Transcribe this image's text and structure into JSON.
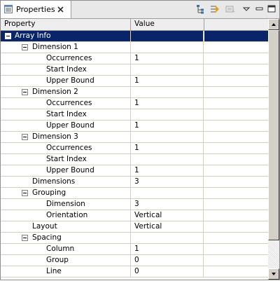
{
  "tab": {
    "title": "Properties",
    "close_icon": "close-icon",
    "view_icon": "properties-view-icon"
  },
  "toolbar": {
    "buttons": [
      {
        "name": "show-categories-button",
        "icon": "categories-icon"
      },
      {
        "name": "show-advanced-button",
        "icon": "filter-icon"
      },
      {
        "name": "restore-default-button",
        "icon": "restore-icon"
      },
      {
        "name": "view-menu-button",
        "icon": "chevron-down-icon"
      },
      {
        "name": "minimize-button",
        "icon": "minimize-icon"
      },
      {
        "name": "maximize-button",
        "icon": "maximize-icon"
      }
    ]
  },
  "table": {
    "columns": [
      "Property",
      "Value"
    ],
    "rows": [
      {
        "label": "Array Info",
        "value": "",
        "level": 0,
        "expandable": true,
        "selected": true
      },
      {
        "label": "Dimension 1",
        "value": "",
        "level": 1,
        "expandable": true
      },
      {
        "label": "Occurrences",
        "value": "1",
        "level": 2
      },
      {
        "label": "Start Index",
        "value": "",
        "level": 2
      },
      {
        "label": "Upper Bound",
        "value": "1",
        "level": 2
      },
      {
        "label": "Dimension 2",
        "value": "",
        "level": 1,
        "expandable": true
      },
      {
        "label": "Occurrences",
        "value": "1",
        "level": 2
      },
      {
        "label": "Start Index",
        "value": "",
        "level": 2
      },
      {
        "label": "Upper Bound",
        "value": "1",
        "level": 2
      },
      {
        "label": "Dimension 3",
        "value": "",
        "level": 1,
        "expandable": true
      },
      {
        "label": "Occurrences",
        "value": "1",
        "level": 2
      },
      {
        "label": "Start Index",
        "value": "",
        "level": 2
      },
      {
        "label": "Upper Bound",
        "value": "1",
        "level": 2
      },
      {
        "label": "Dimensions",
        "value": "3",
        "level": 1
      },
      {
        "label": "Grouping",
        "value": "",
        "level": 1,
        "expandable": true
      },
      {
        "label": "Dimension",
        "value": "3",
        "level": 2
      },
      {
        "label": "Orientation",
        "value": "Vertical",
        "level": 2
      },
      {
        "label": "Layout",
        "value": "Vertical",
        "level": 1
      },
      {
        "label": "Spacing",
        "value": "",
        "level": 1,
        "expandable": true
      },
      {
        "label": "Column",
        "value": "1",
        "level": 2
      },
      {
        "label": "Group",
        "value": "0",
        "level": 2
      },
      {
        "label": "Line",
        "value": "0",
        "level": 2
      }
    ]
  },
  "colors": {
    "selection": "#0a246a",
    "header_bg": "#eeeeee",
    "grid_line": "#d4d0c8"
  }
}
